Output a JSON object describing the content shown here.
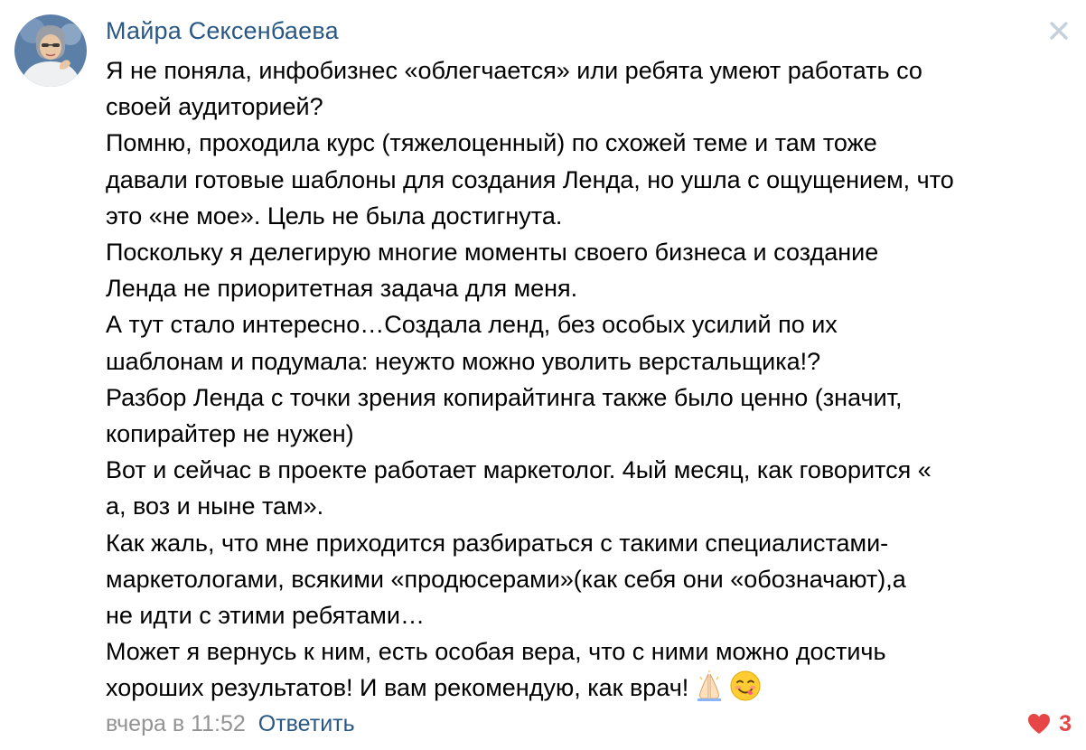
{
  "author": {
    "name": "Майра Сексенбаева"
  },
  "comment": {
    "lines": [
      "Я не поняла, инфобизнес «облегчается» или ребята умеют работать со",
      "своей аудиторией?",
      "Помню, проходила курс (тяжелоценный) по схожей теме и там тоже",
      "давали готовые шаблоны для создания Ленда, но ушла с ощущением, что",
      "это «не мое». Цель не была достигнута.",
      "Поскольку я делегирую многие моменты своего бизнеса и создание",
      "Ленда не приоритетная задача для меня.",
      "А тут стало интересно…Создала ленд, без особых усилий по их",
      "шаблонам и подумала: неужто можно уволить верстальщика!?",
      "Разбор Ленда с точки зрения копирайтинга также было ценно (значит,",
      "копирайтер не нужен)",
      "Вот и сейчас в проекте работает маркетолог. 4ый месяц, как говорится «",
      "а, воз и ныне там».",
      "Как жаль, что мне приходится разбираться с такими специалистами-",
      "маркетологами, всякими «продюсерами»(как себя они «обозначают),а",
      "не идти с этими ребятами…",
      "Может я вернусь к ним, есть особая вера, что с ними можно достичь",
      "хороших результатов! И вам рекомендую, как врач!"
    ],
    "emojis": [
      "folded-hands-icon",
      "savoring-face-icon"
    ]
  },
  "footer": {
    "timestamp": "вчера в 11:52",
    "reply_label": "Ответить"
  },
  "likes": {
    "count": "3",
    "icon": "heart-icon"
  },
  "colors": {
    "link": "#2a5885",
    "meta": "#939393",
    "like": "#e64646",
    "close": "#c5d0db"
  }
}
